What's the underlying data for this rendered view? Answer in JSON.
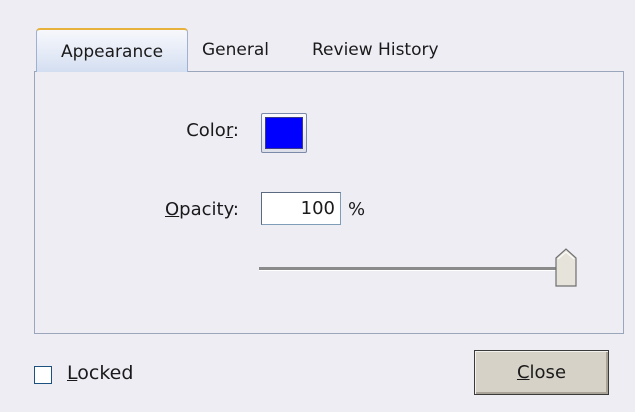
{
  "tabs": {
    "appearance": "Appearance",
    "general": "General",
    "review_history": "Review History"
  },
  "appearance": {
    "color_label_pre": "Colo",
    "color_label_u": "r",
    "color_label_post": ":",
    "color_value": "#0000ff",
    "opacity_label_u": "O",
    "opacity_label_post": "pacity:",
    "opacity_value": "100",
    "opacity_unit": "%",
    "opacity_slider_level": 1.0
  },
  "footer": {
    "locked_label_u": "L",
    "locked_label_post": "ocked",
    "locked_checked": false,
    "close_label_u": "C",
    "close_label_post": "lose"
  },
  "colors": {
    "tab_active_accent": "#e6b23b",
    "dialog_bg": "#eeedf4",
    "swatch_blue": "#0000ff"
  }
}
